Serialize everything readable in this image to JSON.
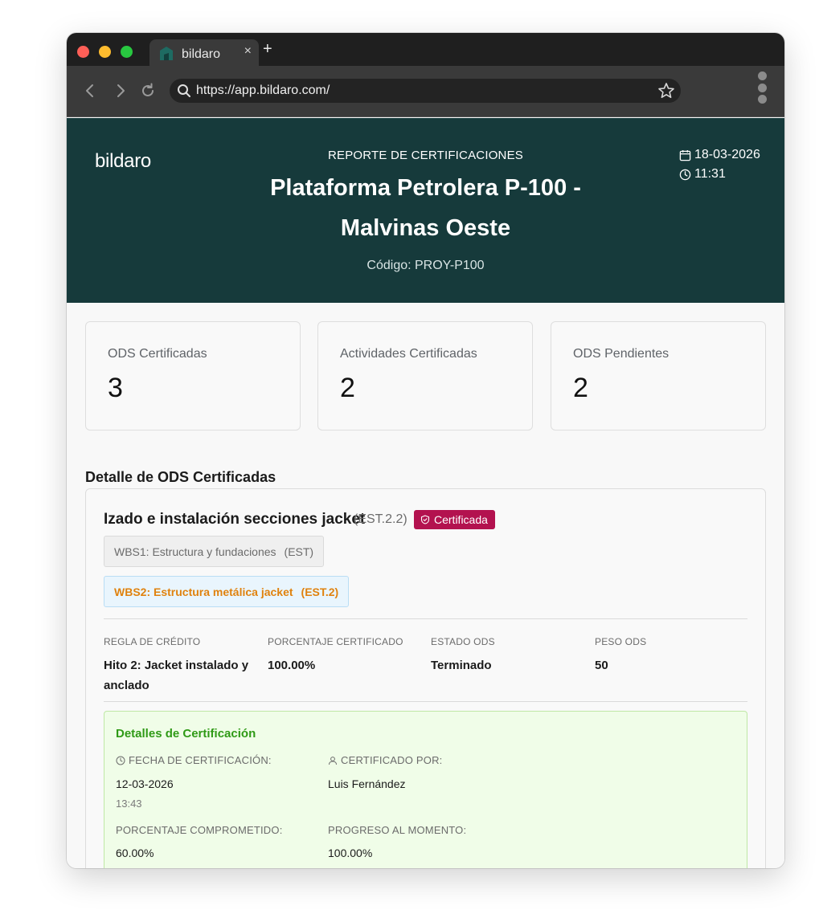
{
  "browser": {
    "tab_title": "bildaro",
    "new_tab": "+",
    "tab_close": "×",
    "url": "https://app.bildaro.com/"
  },
  "header": {
    "logo": "bildaro",
    "report_label": "REPORTE DE CERTIFICACIONES",
    "project_name": "Plataforma Petrolera P-100 - Malvinas Oeste",
    "project_code": "Código: PROY-P100",
    "date": "18-03-2026",
    "time": "11:31"
  },
  "stats": [
    {
      "label": "ODS Certificadas",
      "value": "3"
    },
    {
      "label": "Actividades Certificadas",
      "value": "2"
    },
    {
      "label": "ODS Pendientes",
      "value": "2"
    }
  ],
  "section": {
    "title": "Detalle de ODS Certificadas"
  },
  "ods": {
    "title": "Izado e instalación secciones jacket",
    "code": "(EST.2.2)",
    "badge": "Certificada",
    "wbs1": {
      "label": "WBS1: Estructura y fundaciones",
      "code": "(EST)"
    },
    "wbs2": {
      "label": "WBS2: Estructura metálica jacket",
      "code": "(EST.2)"
    },
    "columns": [
      {
        "label": "REGLA DE CRÉDITO",
        "value": "Hito 2: Jacket instalado y anclado"
      },
      {
        "label": "PORCENTAJE CERTIFICADO",
        "value": "100.00%"
      },
      {
        "label": "ESTADO ODS",
        "value": "Terminado"
      },
      {
        "label": "PESO ODS",
        "value": "50"
      }
    ],
    "certification": {
      "title": "Detalles de Certificación",
      "date_label": "FECHA DE CERTIFICACIÓN:",
      "date_value": "12-03-2026",
      "time_value": "13:43",
      "by_label": "CERTIFICADO POR:",
      "by_value": "Luis Fernández",
      "committed_label": "PORCENTAJE COMPROMETIDO:",
      "committed_value": "60.00%",
      "progress_label": "PROGRESO AL MOMENTO:",
      "progress_value": "100.00%"
    }
  },
  "colors": {
    "header_bg": "#163a3b",
    "badge_bg": "#b3124f",
    "wbs2_text": "#e0820e",
    "cert_title": "#2f9a16",
    "cert_bg": "#f0fde8"
  }
}
